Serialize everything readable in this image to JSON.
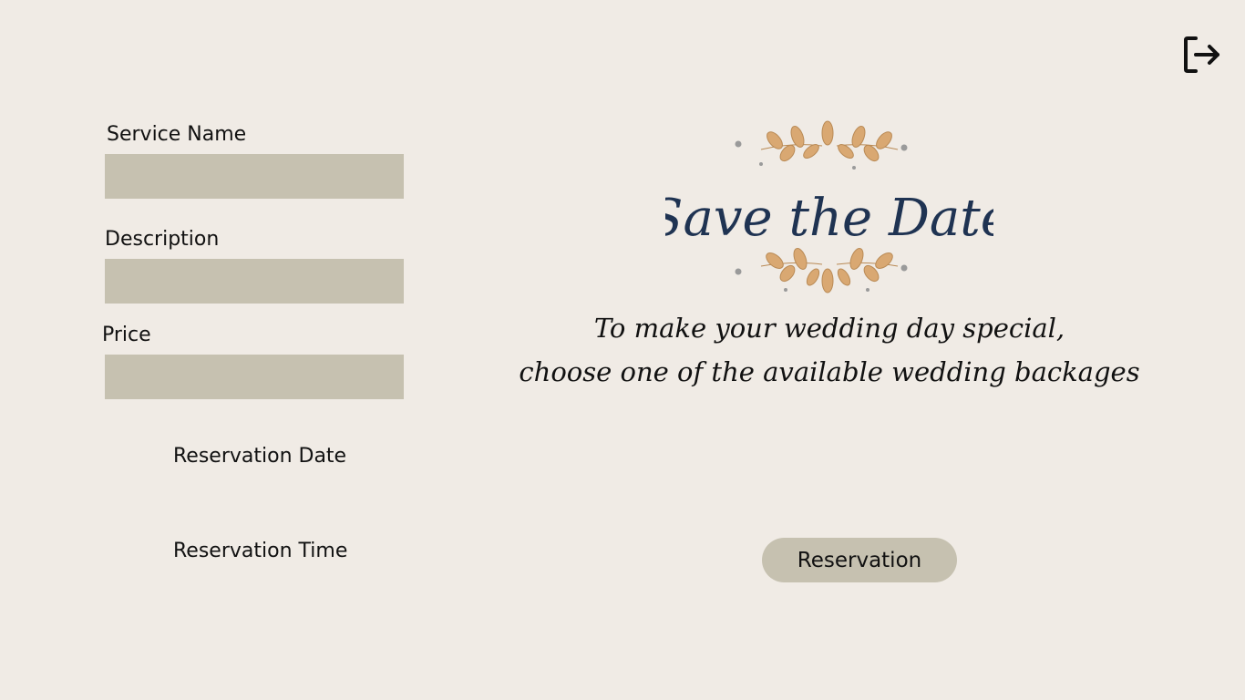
{
  "form": {
    "service_name": {
      "label": "Service Name",
      "value": "",
      "placeholder": ""
    },
    "description": {
      "label": "Description",
      "value": "",
      "placeholder": ""
    },
    "price": {
      "label": "Price",
      "value": "",
      "placeholder": ""
    },
    "reservation_date_label": "Reservation Date",
    "reservation_time_label": "Reservation Time"
  },
  "header": {
    "logout_icon": "logout-icon"
  },
  "banner": {
    "logo_text": "Save the Date",
    "tagline_line1": "To make your wedding day special,",
    "tagline_line2": "choose one of the available wedding backages"
  },
  "actions": {
    "reservation_label": "Reservation"
  },
  "colors": {
    "background": "#f0ebe5",
    "field": "#c6c1b0",
    "logo_navy": "#1f3352",
    "leaf_gold": "#d9a872",
    "dot_gray": "#9a9a9a"
  }
}
